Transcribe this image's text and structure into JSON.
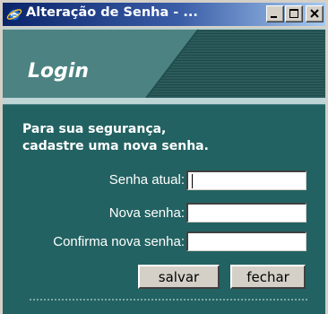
{
  "window": {
    "title": "Alteração de Senha - ...",
    "app_icon": "ie-icon",
    "controls": {
      "minimize": "minimize-icon",
      "maximize": "maximize-icon",
      "close": "close-icon"
    }
  },
  "header": {
    "title": "Login"
  },
  "message": {
    "line1": "Para sua segurança,",
    "line2": "cadastre uma nova senha."
  },
  "form": {
    "current_password_label": "Senha atual:",
    "current_password_value": "",
    "new_password_label": "Nova senha:",
    "new_password_value": "",
    "confirm_password_label": "Confirma nova senha:",
    "confirm_password_value": ""
  },
  "buttons": {
    "save_label": "salvar",
    "close_label": "fechar"
  },
  "colors": {
    "titlebar_start": "#0a246a",
    "titlebar_end": "#a6caf0",
    "panel_dark": "#236262",
    "panel_header": "#4c8282",
    "window_face": "#d4d0c8"
  }
}
